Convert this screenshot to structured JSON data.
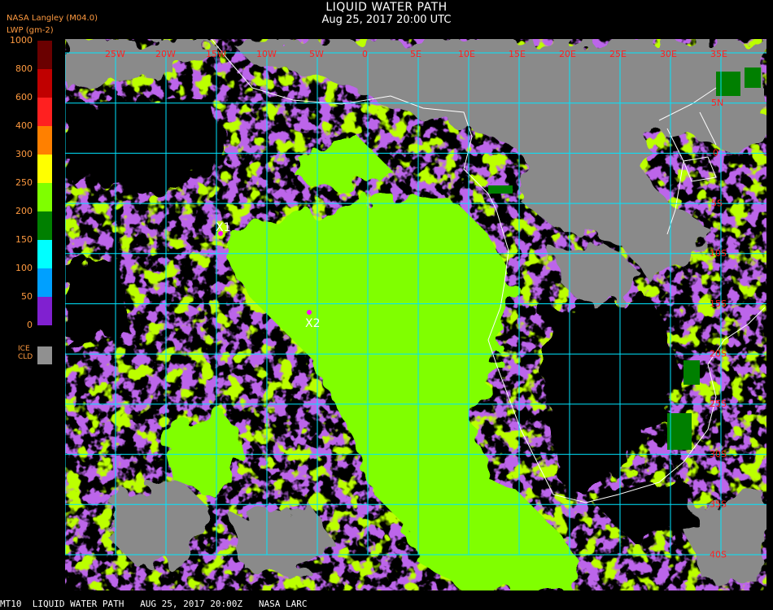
{
  "header": {
    "title": "LIQUID WATER PATH",
    "datetime": "Aug 25, 2017 20:00 UTC",
    "source": "NASA Langley (M04.0)",
    "unit": "LWP (gm-2)"
  },
  "colorbar": {
    "labels": [
      "1000",
      "800",
      "600",
      "400",
      "300",
      "250",
      "200",
      "150",
      "100",
      "50",
      "0"
    ],
    "colors": [
      "#6a0000",
      "#c00000",
      "#ff2020",
      "#ff8000",
      "#ffff00",
      "#7fff00",
      "#007f00",
      "#00ffff",
      "#00a0ff",
      "#0000ff",
      "#8020d0"
    ],
    "ice_label": [
      "ICE",
      "CLD"
    ],
    "ice_color": "#909090"
  },
  "map": {
    "longitude_labels": [
      "25W",
      "20W",
      "15W",
      "10W",
      "5W",
      "0",
      "5E",
      "10E",
      "15E",
      "20E",
      "25E",
      "30E",
      "35E"
    ],
    "latitude_labels": [
      "5N",
      "0",
      "5S",
      "10S",
      "15S",
      "20S",
      "25S",
      "30S",
      "35S",
      "40S"
    ],
    "markers": [
      {
        "label": "X1",
        "color": "#ff00ff"
      },
      {
        "label": "X2",
        "color": "#ff00ff"
      }
    ],
    "grid_color": "#00e5ff",
    "label_color": "#ff2020",
    "coast_color": "#ffffff",
    "land_color": "#8a8a8a",
    "liquid_color": "#80ff00",
    "low_lwp_color": "#8020d0"
  },
  "footer": {
    "text": "MT10  LIQUID WATER PATH   AUG 25, 2017 20:00Z   NASA LARC"
  }
}
